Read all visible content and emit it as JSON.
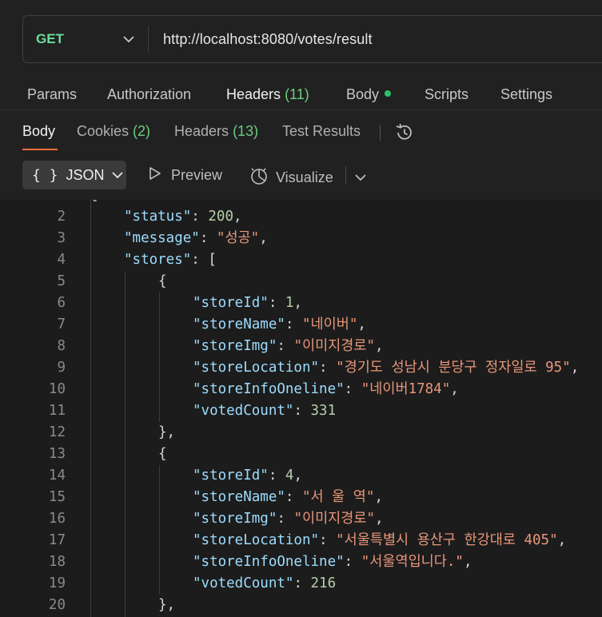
{
  "request": {
    "method": "GET",
    "url": "http://localhost:8080/votes/result"
  },
  "request_tabs": {
    "params": "Params",
    "authorization": "Authorization",
    "headers": "Headers",
    "headers_count": "(11)",
    "body": "Body",
    "scripts": "Scripts",
    "settings": "Settings"
  },
  "response_tabs": {
    "body": "Body",
    "cookies": "Cookies",
    "cookies_count": "(2)",
    "headers": "Headers",
    "headers_count": "(13)",
    "test_results": "Test Results"
  },
  "toolbar": {
    "format_braces": "{ }",
    "format": "JSON",
    "preview": "Preview",
    "visualize": "Visualize"
  },
  "colors": {
    "accent": "#ff6c37",
    "method_get": "#6bdd9a",
    "count_green": "#6bcd80",
    "json_key": "#9cdcfe",
    "json_string": "#e9967a",
    "json_number": "#b5cea8"
  },
  "code_lines": [
    {
      "n": "2",
      "indent": 1,
      "tokens": [
        [
          "key",
          "\"status\""
        ],
        [
          "punc",
          ": "
        ],
        [
          "num",
          "200"
        ],
        [
          "punc",
          ","
        ]
      ]
    },
    {
      "n": "3",
      "indent": 1,
      "tokens": [
        [
          "key",
          "\"message\""
        ],
        [
          "punc",
          ": "
        ],
        [
          "str",
          "\"성공\""
        ],
        [
          "punc",
          ","
        ]
      ]
    },
    {
      "n": "4",
      "indent": 1,
      "tokens": [
        [
          "key",
          "\"stores\""
        ],
        [
          "punc",
          ": ["
        ]
      ]
    },
    {
      "n": "5",
      "indent": 2,
      "tokens": [
        [
          "punc",
          "{"
        ]
      ]
    },
    {
      "n": "6",
      "indent": 3,
      "tokens": [
        [
          "key",
          "\"storeId\""
        ],
        [
          "punc",
          ": "
        ],
        [
          "num",
          "1"
        ],
        [
          "punc",
          ","
        ]
      ]
    },
    {
      "n": "7",
      "indent": 3,
      "tokens": [
        [
          "key",
          "\"storeName\""
        ],
        [
          "punc",
          ": "
        ],
        [
          "str",
          "\"네이버\""
        ],
        [
          "punc",
          ","
        ]
      ]
    },
    {
      "n": "8",
      "indent": 3,
      "tokens": [
        [
          "key",
          "\"storeImg\""
        ],
        [
          "punc",
          ": "
        ],
        [
          "str",
          "\"이미지경로\""
        ],
        [
          "punc",
          ","
        ]
      ]
    },
    {
      "n": "9",
      "indent": 3,
      "tokens": [
        [
          "key",
          "\"storeLocation\""
        ],
        [
          "punc",
          ": "
        ],
        [
          "str",
          "\"경기도 성남시 분당구 정자일로 95\""
        ],
        [
          "punc",
          ","
        ]
      ]
    },
    {
      "n": "10",
      "indent": 3,
      "tokens": [
        [
          "key",
          "\"storeInfoOneline\""
        ],
        [
          "punc",
          ": "
        ],
        [
          "str",
          "\"네이버1784\""
        ],
        [
          "punc",
          ","
        ]
      ]
    },
    {
      "n": "11",
      "indent": 3,
      "tokens": [
        [
          "key",
          "\"votedCount\""
        ],
        [
          "punc",
          ": "
        ],
        [
          "num",
          "331"
        ]
      ]
    },
    {
      "n": "12",
      "indent": 2,
      "tokens": [
        [
          "punc",
          "},"
        ]
      ]
    },
    {
      "n": "13",
      "indent": 2,
      "tokens": [
        [
          "punc",
          "{"
        ]
      ]
    },
    {
      "n": "14",
      "indent": 3,
      "tokens": [
        [
          "key",
          "\"storeId\""
        ],
        [
          "punc",
          ": "
        ],
        [
          "num",
          "4"
        ],
        [
          "punc",
          ","
        ]
      ]
    },
    {
      "n": "15",
      "indent": 3,
      "tokens": [
        [
          "key",
          "\"storeName\""
        ],
        [
          "punc",
          ": "
        ],
        [
          "str",
          "\"서 울 역\""
        ],
        [
          "punc",
          ","
        ]
      ]
    },
    {
      "n": "16",
      "indent": 3,
      "tokens": [
        [
          "key",
          "\"storeImg\""
        ],
        [
          "punc",
          ": "
        ],
        [
          "str",
          "\"이미지경로\""
        ],
        [
          "punc",
          ","
        ]
      ]
    },
    {
      "n": "17",
      "indent": 3,
      "tokens": [
        [
          "key",
          "\"storeLocation\""
        ],
        [
          "punc",
          ": "
        ],
        [
          "str",
          "\"서울특별시 용산구 한강대로 405\""
        ],
        [
          "punc",
          ","
        ]
      ]
    },
    {
      "n": "18",
      "indent": 3,
      "tokens": [
        [
          "key",
          "\"storeInfoOneline\""
        ],
        [
          "punc",
          ": "
        ],
        [
          "str",
          "\"서울역입니다.\""
        ],
        [
          "punc",
          ","
        ]
      ]
    },
    {
      "n": "19",
      "indent": 3,
      "tokens": [
        [
          "key",
          "\"votedCount\""
        ],
        [
          "punc",
          ": "
        ],
        [
          "num",
          "216"
        ]
      ]
    },
    {
      "n": "20",
      "indent": 2,
      "tokens": [
        [
          "punc",
          "},"
        ]
      ]
    }
  ]
}
